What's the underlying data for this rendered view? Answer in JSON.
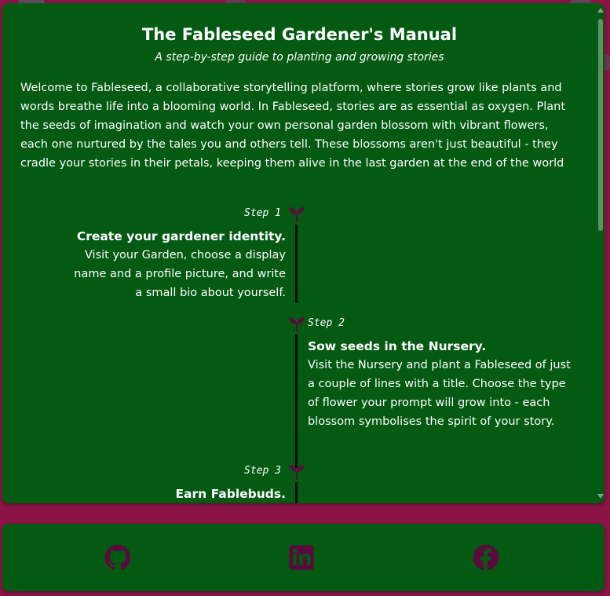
{
  "manual": {
    "title": "The Fableseed Gardener's Manual",
    "subtitle": "A step-by-step guide to planting and growing stories",
    "intro": "Welcome to Fableseed, a collaborative storytelling platform, where stories grow like plants and words breathe life into a blooming world. In Fableseed, stories are as essential as oxygen. Plant the seeds of imagination and watch your own personal garden blossom with vibrant flowers, each one nurtured by the tales you and others tell. These blossoms aren't just beautiful - they cradle your stories in their petals, keeping them alive in the last garden at the end of the world",
    "steps": [
      {
        "label": "Step 1",
        "title": "Create your gardener identity.",
        "description": "Visit your Garden, choose a display name and a profile picture, and write a small bio about yourself."
      },
      {
        "label": "Step 2",
        "title": "Sow seeds in the Nursery.",
        "description": "Visit the Nursery and plant a Fableseed of just a couple of lines with a title. Choose the type of flower your prompt will grow into - each blossom symbolises the spirit of your story."
      },
      {
        "label": "Step 3",
        "title": "Earn Fablebuds.",
        "description": ""
      }
    ]
  },
  "footer": {
    "links": [
      {
        "icon": "github-icon"
      },
      {
        "icon": "linkedin-icon"
      },
      {
        "icon": "facebook-icon"
      }
    ]
  },
  "colors": {
    "page_background": "#8a1446",
    "card_background": "#045a12",
    "text": "#ffffff",
    "accent_icon": "#5a0a3c",
    "timeline": "#0a0a0a"
  }
}
